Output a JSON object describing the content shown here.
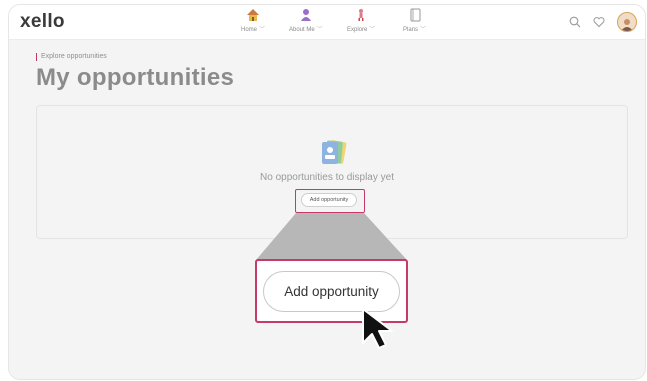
{
  "app": {
    "logo": "xello"
  },
  "nav": [
    {
      "label": "Home",
      "icon": "home-icon"
    },
    {
      "label": "About Me",
      "icon": "person-icon"
    },
    {
      "label": "Explore",
      "icon": "explore-figure-icon"
    },
    {
      "label": "Plans",
      "icon": "plans-notebook-icon"
    }
  ],
  "header_right": {
    "icons": [
      "search-icon",
      "heart-icon",
      "avatar"
    ]
  },
  "breadcrumb": "Explore opportunities",
  "page_title": "My opportunities",
  "empty_state": {
    "message": "No opportunities to display yet",
    "icon": "documents-icon",
    "button_label": "Add opportunity"
  },
  "zoom_callout": {
    "button_label": "Add opportunity"
  },
  "colors": {
    "highlight": "#c63a67",
    "title": "#8b8b8b",
    "background": "#f4f4f4"
  }
}
